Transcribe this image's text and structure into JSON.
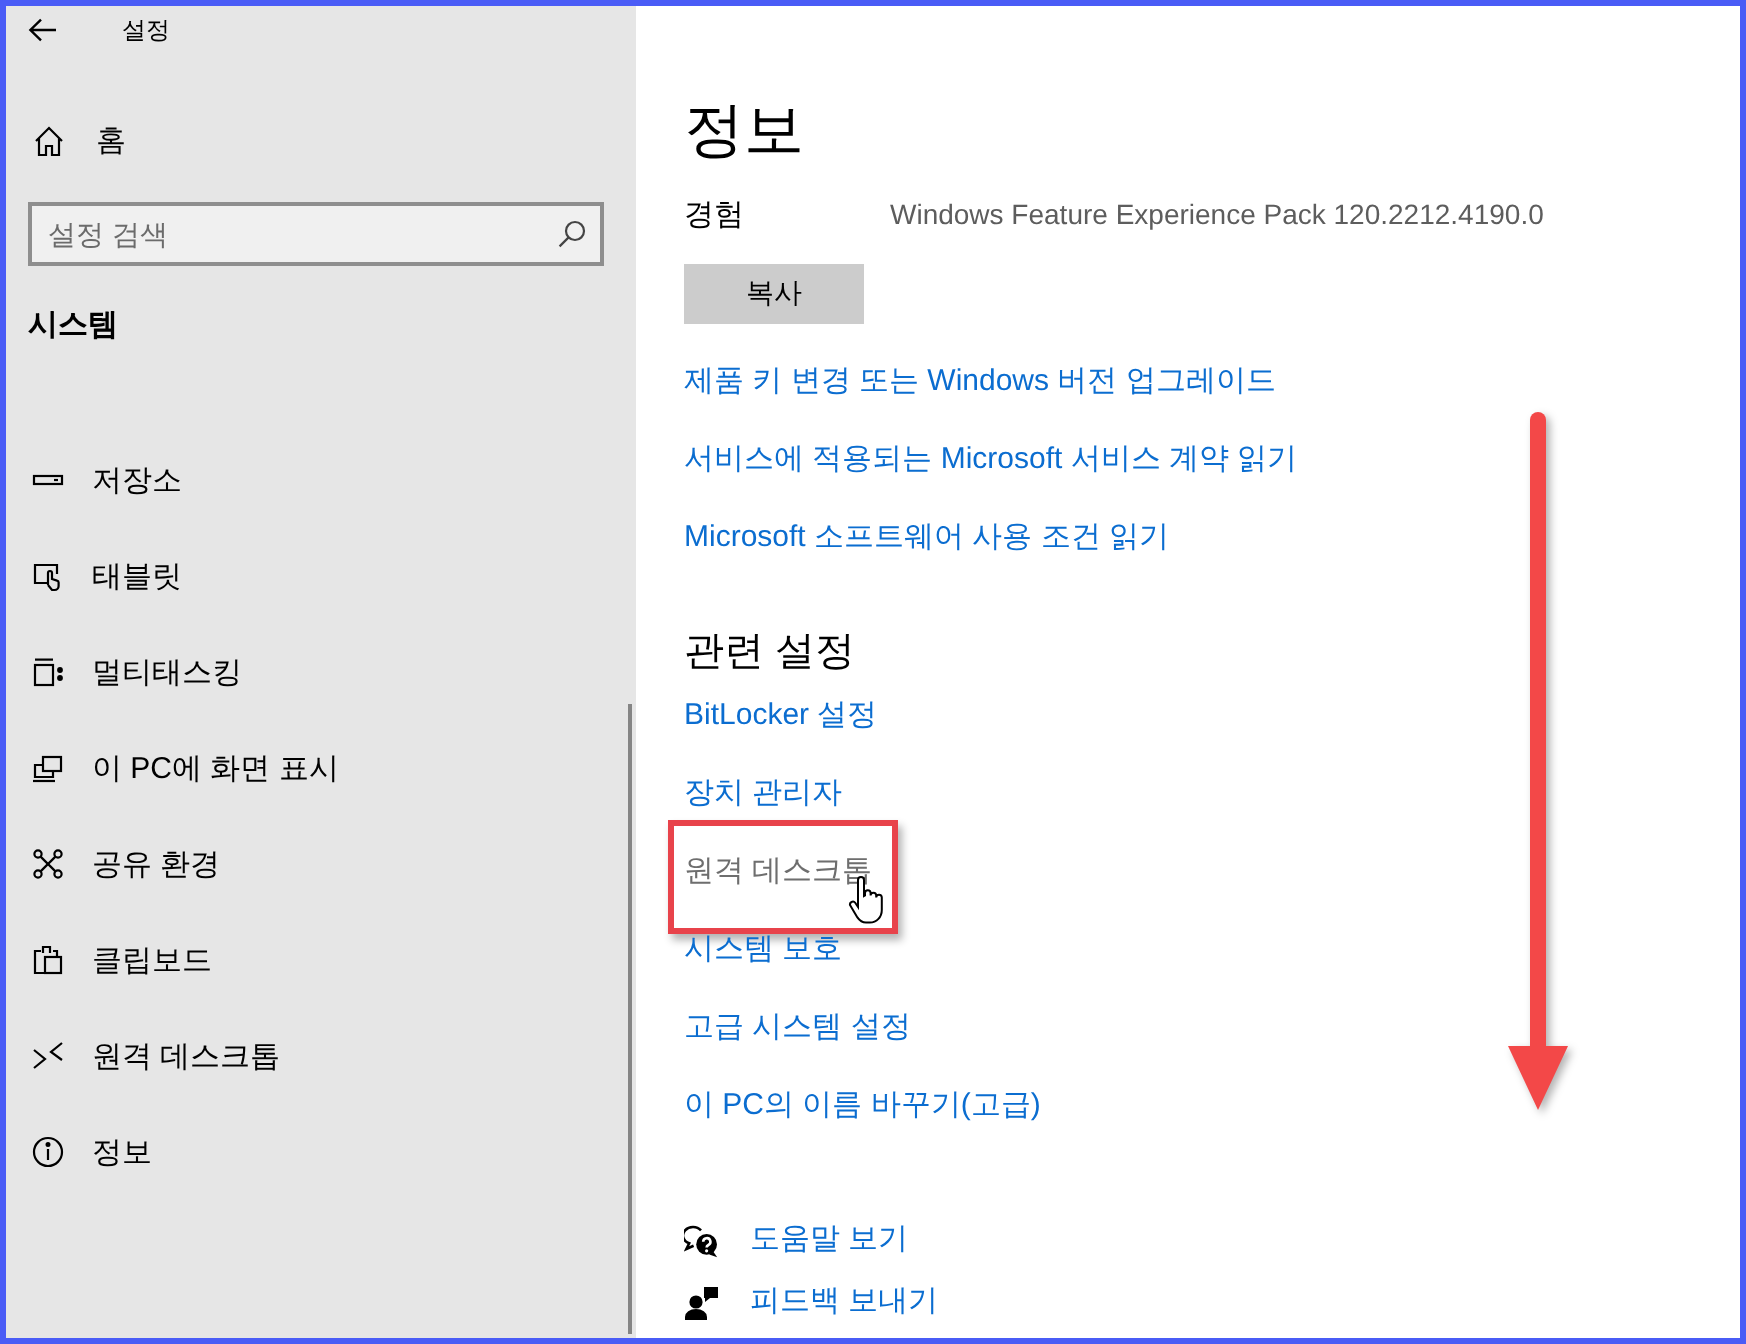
{
  "window": {
    "title": "설정"
  },
  "sidebar": {
    "home": "홈",
    "search": {
      "placeholder": "설정 검색"
    },
    "section_title": "시스템",
    "items": [
      {
        "label": "저장소"
      },
      {
        "label": "태블릿"
      },
      {
        "label": "멀티태스킹"
      },
      {
        "label": "이 PC에 화면 표시"
      },
      {
        "label": "공유 환경"
      },
      {
        "label": "클립보드"
      },
      {
        "label": "원격 데스크톱"
      },
      {
        "label": "정보"
      }
    ]
  },
  "page": {
    "title": "정보",
    "specs": [
      {
        "label": "경험",
        "value": "Windows Feature Experience Pack 120.2212.4190.0"
      }
    ],
    "copy_button": "복사",
    "links": [
      "제품 키 변경 또는 Windows 버전 업그레이드",
      "서비스에 적용되는 Microsoft 서비스 계약 읽기",
      "Microsoft 소프트웨어 사용 조건 읽기"
    ],
    "related_settings": {
      "title": "관련 설정",
      "links": [
        {
          "label": "BitLocker 설정",
          "hovered": false,
          "outlined": false
        },
        {
          "label": "장치 관리자",
          "hovered": false,
          "outlined": false
        },
        {
          "label": "원격 데스크톱",
          "hovered": true,
          "outlined": true
        },
        {
          "label": "시스템 보호",
          "hovered": false,
          "outlined": false
        },
        {
          "label": "고급 시스템 설정",
          "hovered": false,
          "outlined": false
        },
        {
          "label": "이 PC의 이름 바꾸기(고급)",
          "hovered": false,
          "outlined": false
        }
      ]
    },
    "help_links": [
      "도움말 보기",
      "피드백 보내기"
    ]
  }
}
